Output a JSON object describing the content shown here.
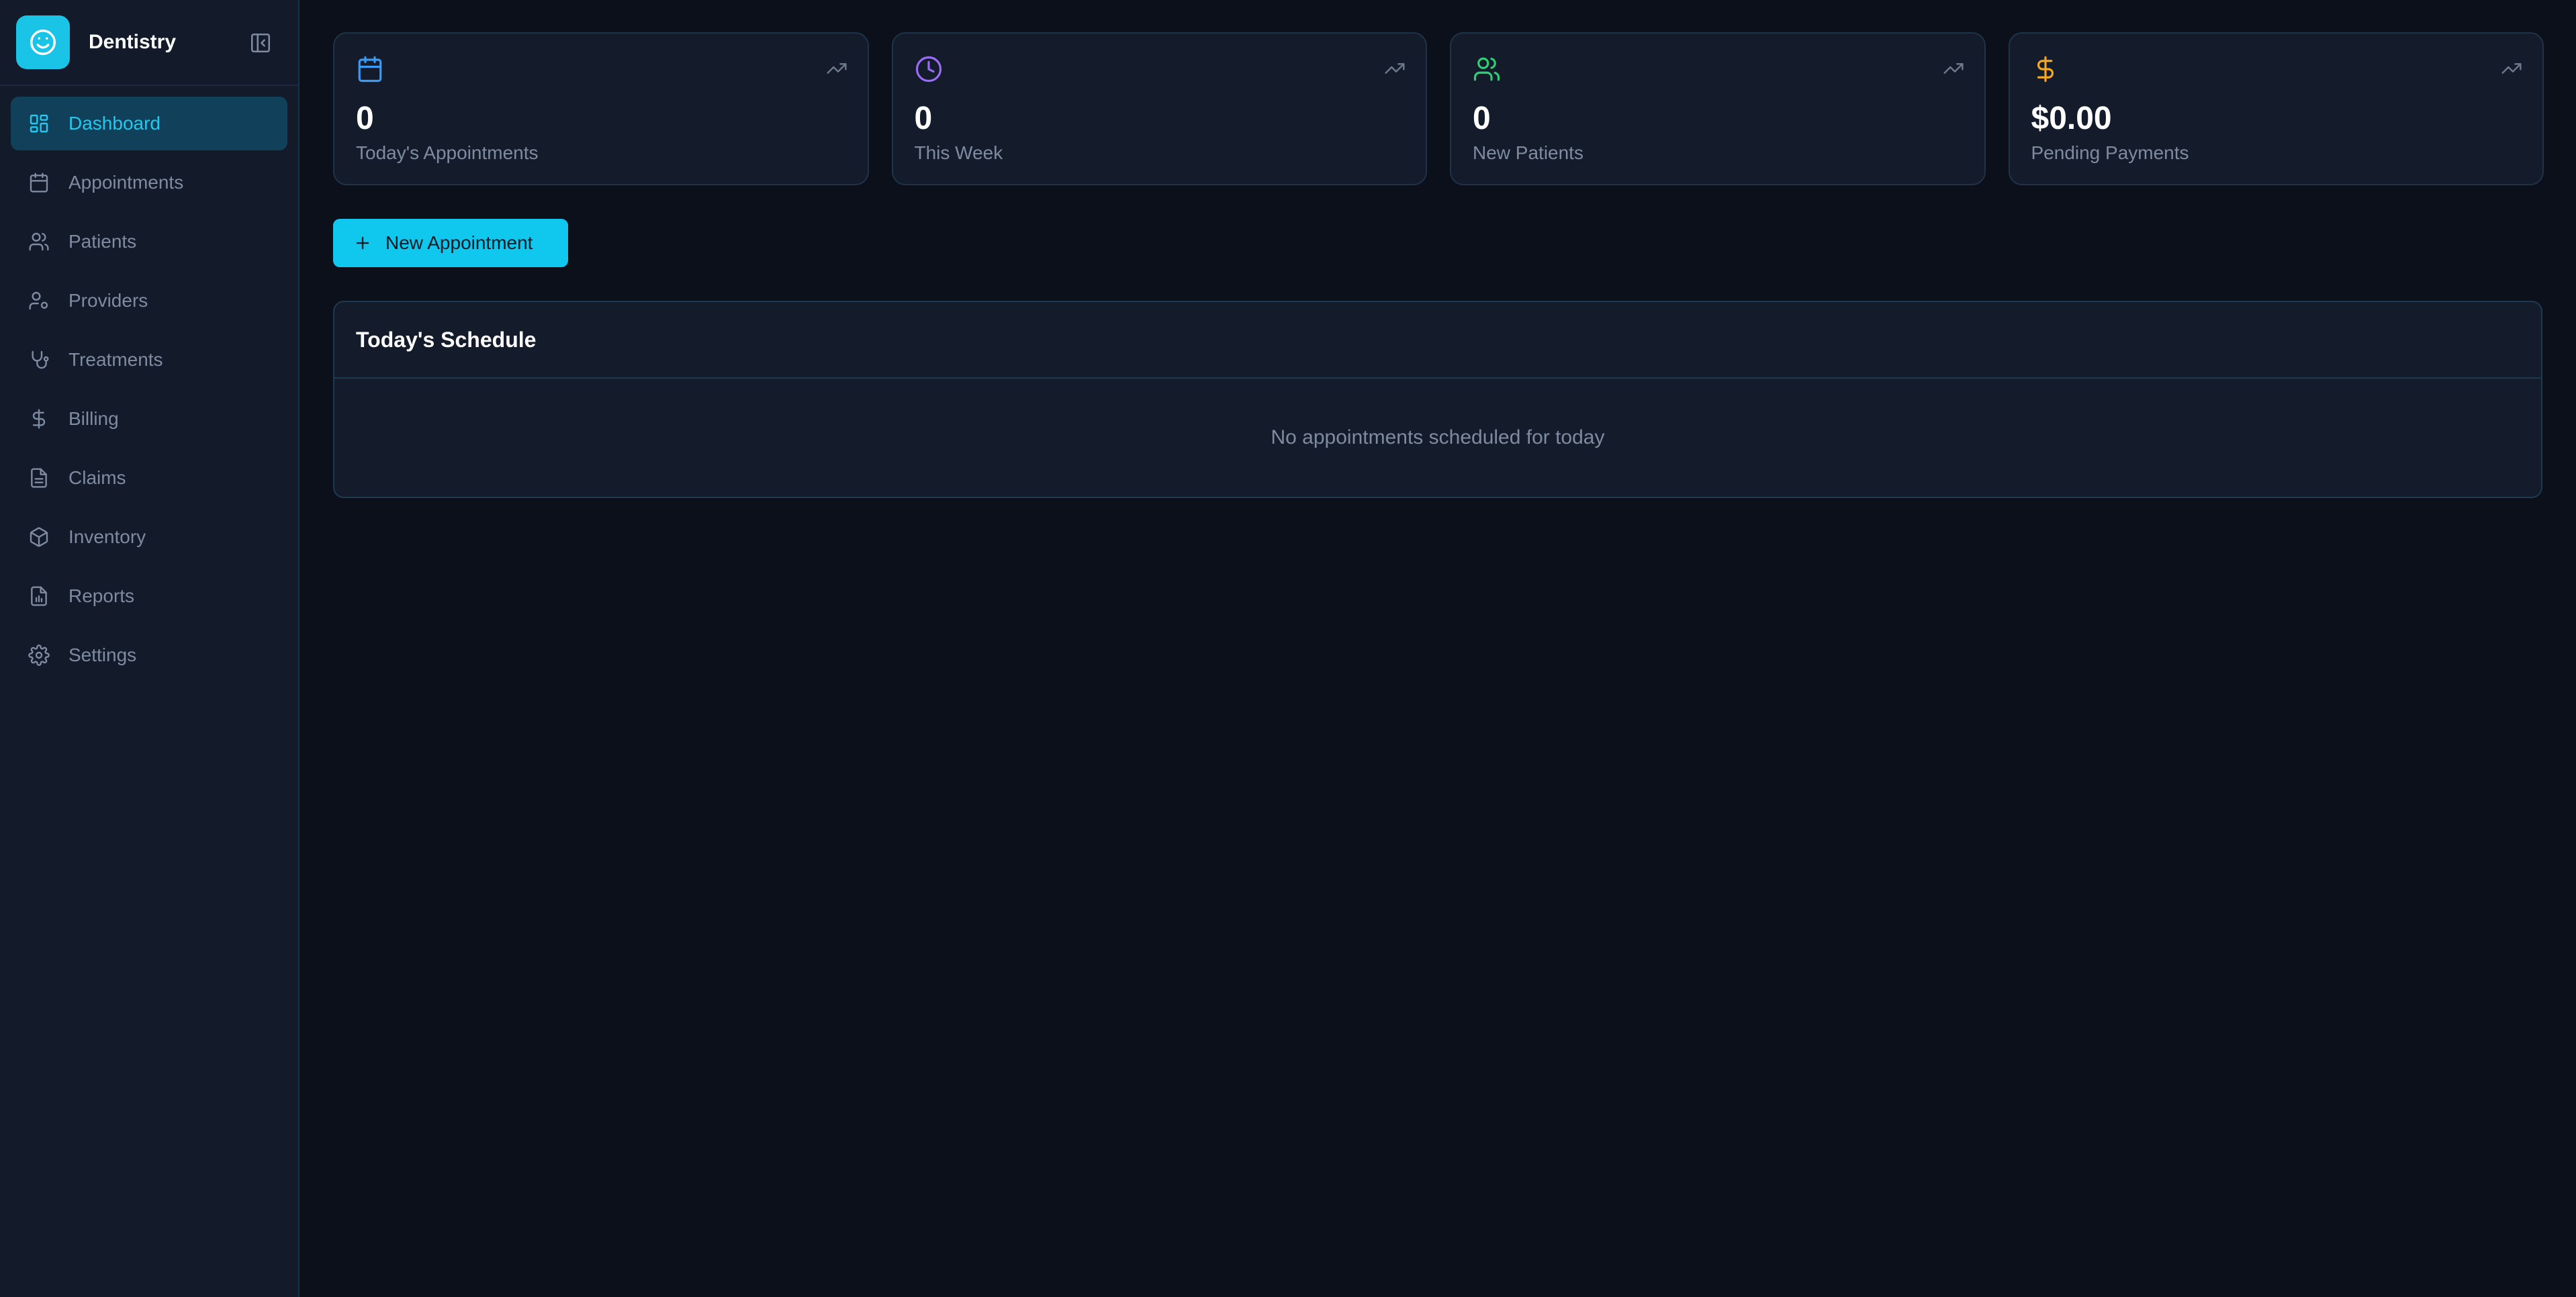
{
  "app": {
    "name": "Dentistry"
  },
  "sidebar": {
    "items": [
      {
        "label": "Dashboard",
        "icon": "dashboard-icon",
        "active": true
      },
      {
        "label": "Appointments",
        "icon": "calendar-icon"
      },
      {
        "label": "Patients",
        "icon": "users-icon"
      },
      {
        "label": "Providers",
        "icon": "user-gear-icon"
      },
      {
        "label": "Treatments",
        "icon": "stethoscope-icon"
      },
      {
        "label": "Billing",
        "icon": "dollar-icon"
      },
      {
        "label": "Claims",
        "icon": "file-text-icon"
      },
      {
        "label": "Inventory",
        "icon": "package-icon"
      },
      {
        "label": "Reports",
        "icon": "report-icon"
      },
      {
        "label": "Settings",
        "icon": "gear-icon"
      }
    ]
  },
  "stats": [
    {
      "value": "0",
      "label": "Today's Appointments",
      "icon": "calendar-icon",
      "color": "#3b9bf5"
    },
    {
      "value": "0",
      "label": "This Week",
      "icon": "clock-icon",
      "color": "#9b6cf5"
    },
    {
      "value": "0",
      "label": "New Patients",
      "icon": "users-icon",
      "color": "#2fcf76"
    },
    {
      "value": "$0.00",
      "label": "Pending Payments",
      "icon": "dollar-icon",
      "color": "#f5a623"
    }
  ],
  "actions": {
    "new_appointment": "New Appointment"
  },
  "schedule": {
    "title": "Today's Schedule",
    "empty_message": "No appointments scheduled for today"
  },
  "colors": {
    "accent": "#10c8ee",
    "background": "#0b101b",
    "sidebar": "#131b2b"
  }
}
